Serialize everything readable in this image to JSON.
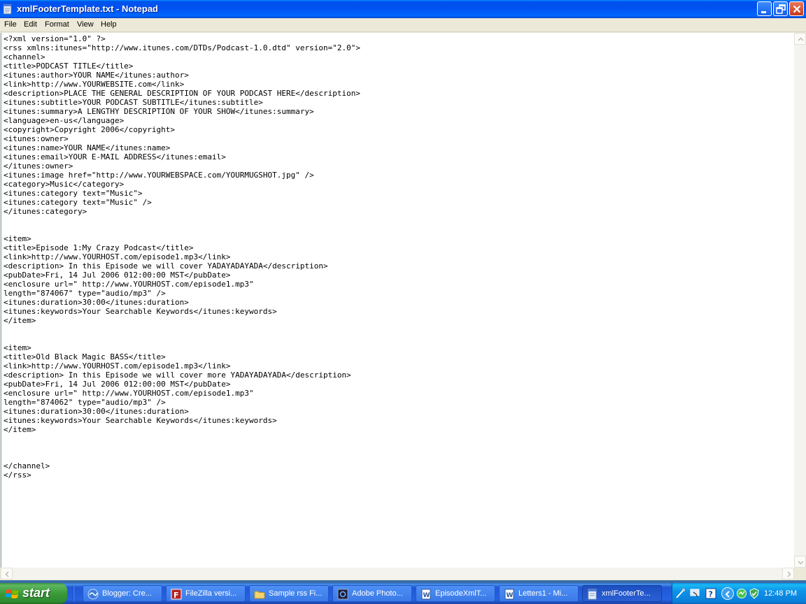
{
  "window": {
    "title": "xmlFooterTemplate.txt - Notepad"
  },
  "menu": {
    "file": "File",
    "edit": "Edit",
    "format": "Format",
    "view": "View",
    "help": "Help"
  },
  "editor": {
    "content": "<?xml version=\"1.0\" ?>\n<rss xmlns:itunes=\"http://www.itunes.com/DTDs/Podcast-1.0.dtd\" version=\"2.0\">\n<channel>\n<title>PODCAST TITLE</title>\n<itunes:author>YOUR NAME</itunes:author>\n<link>http://www.YOURWEBSITE.com</link>\n<description>PLACE THE GENERAL DESCRIPTION OF YOUR PODCAST HERE</description>\n<itunes:subtitle>YOUR PODCAST SUBTITLE</itunes:subtitle>\n<itunes:summary>A LENGTHY DESCRIPTION OF YOUR SHOW</itunes:summary>\n<language>en-us</language>\n<copyright>Copyright 2006</copyright>\n<itunes:owner>\n<itunes:name>YOUR NAME</itunes:name>\n<itunes:email>YOUR E-MAIL ADDRESS</itunes:email>\n</itunes:owner>\n<itunes:image href=\"http://www.YOURWEBSPACE.com/YOURMUGSHOT.jpg\" />\n<category>Music</category>\n<itunes:category text=\"Music\">\n<itunes:category text=\"Music\" />\n</itunes:category>\n\n\n<item>\n<title>Episode 1:My Crazy Podcast</title>\n<link>http://www.YOURHOST.com/episode1.mp3</link>\n<description> In this Episode we will cover YADAYADAYADA</description>\n<pubDate>Fri, 14 Jul 2006 012:00:00 MST</pubDate>\n<enclosure url=\" http://www.YOURHOST.com/episode1.mp3\"\nlength=\"874067\" type=\"audio/mp3\" />\n<itunes:duration>30:00</itunes:duration>\n<itunes:keywords>Your Searchable Keywords</itunes:keywords>\n</item>\n\n\n<item>\n<title>Old Black Magic BASS</title>\n<link>http://www.YOURHOST.com/episode1.mp3</link>\n<description> In this Episode we will cover more YADAYADAYADA</description>\n<pubDate>Fri, 14 Jul 2006 012:00:00 MST</pubDate>\n<enclosure url=\" http://www.YOURHOST.com/episode1.mp3\"\nlength=\"874062\" type=\"audio/mp3\" />\n<itunes:duration>30:00</itunes:duration>\n<itunes:keywords>Your Searchable Keywords</itunes:keywords>\n</item>\n\n\n\n</channel>\n</rss>"
  },
  "taskbar": {
    "start_label": "start",
    "items": [
      {
        "label": "Blogger: Cre...",
        "icon": "browser-icon"
      },
      {
        "label": "FileZilla versi...",
        "icon": "filezilla-icon"
      },
      {
        "label": "Sample rss Fi...",
        "icon": "folder-icon"
      },
      {
        "label": "Adobe Photo...",
        "icon": "photoshop-icon"
      },
      {
        "label": "EpisodeXmlT...",
        "icon": "word-icon"
      },
      {
        "label": "Letters1 - Mi...",
        "icon": "word-icon"
      },
      {
        "label": "xmlFooterTe...",
        "icon": "notepad-icon",
        "active": true
      }
    ],
    "clock": "12:48 PM"
  },
  "colors": {
    "titlebar": "#0053ee",
    "taskbar": "#2663e0",
    "start": "#3a9a3a",
    "tray": "#0c91e8"
  }
}
